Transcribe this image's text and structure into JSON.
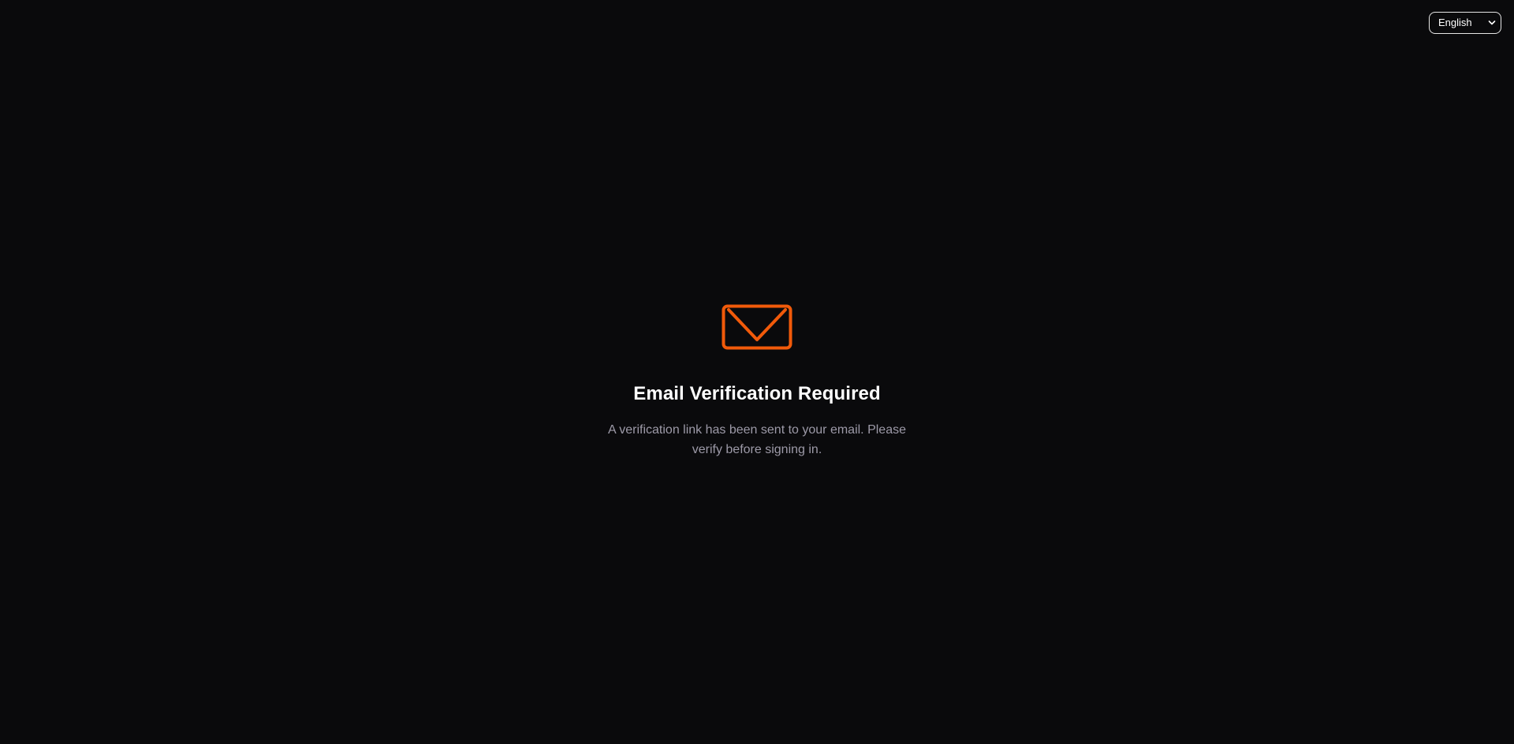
{
  "language_selector": {
    "selected": "English",
    "options": [
      "English"
    ]
  },
  "verification": {
    "icon": "mail-icon",
    "title": "Email Verification Required",
    "message": "A verification link has been sent to your email. Please verify before signing in."
  },
  "colors": {
    "background": "#0a0a0c",
    "accent": "#f15a0a",
    "title": "#ffffff",
    "message": "#9d9aa8"
  }
}
